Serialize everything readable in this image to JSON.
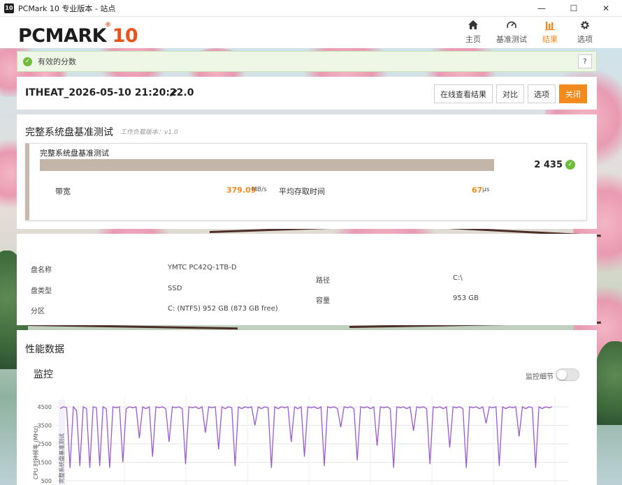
{
  "window": {
    "app_icon": "10",
    "title": "PCMark 10 专业版本 - 站点",
    "controls": [
      "—",
      "☐",
      "✕"
    ]
  },
  "logo": {
    "text": "PCMARK",
    "number": "10",
    "mark": "®"
  },
  "nav": {
    "items": [
      {
        "label": "主页",
        "icon": "home-icon"
      },
      {
        "label": "基准测试",
        "icon": "gauge-icon"
      },
      {
        "label": "结果",
        "icon": "bar-chart-icon",
        "active": true
      },
      {
        "label": "选项",
        "icon": "gear-icon"
      }
    ]
  },
  "colors": {
    "accent": "#f28a1e",
    "valid": "#6fbb3a",
    "series": "#9b59d0"
  },
  "validity": {
    "text": "有效的分数",
    "help": "?"
  },
  "result": {
    "name": "ITHEAT_2026-05-10 21:20:22.0",
    "buttons": {
      "online": "在线查看结果",
      "compare": "对比",
      "options": "选项",
      "close": "关闭"
    }
  },
  "benchmark": {
    "title": "完整系统盘基准测试",
    "version": "工作负载版本：v1.0",
    "inner_title": "完整系统盘基准测试",
    "score": "2 435",
    "bandwidth_label": "带宽",
    "bandwidth_value": "379.09",
    "bandwidth_unit": "MB/s",
    "latency_label": "平均存取时间",
    "latency_value": "67",
    "latency_unit": "μs"
  },
  "drive": {
    "name_label": "盘名称",
    "name_value": "YMTC PC42Q-1TB-D",
    "type_label": "盘类型",
    "type_value": "SSD",
    "partition_label": "分区",
    "partition_value": "C: (NTFS) 952 GB (873 GB free)",
    "path_label": "路径",
    "path_value": "C:\\",
    "capacity_label": "容量",
    "capacity_value": "953 GB"
  },
  "performance": {
    "title": "性能数据",
    "monitor_title": "监控",
    "toggle_label": "监控细节",
    "toggle_on": false
  },
  "chart_data": {
    "type": "line",
    "ylabel": "CPU 时钟频率 (MHz)",
    "overlay_label": "完整系统盘基准测试",
    "yticks": [
      500,
      1500,
      2500,
      3500,
      4500
    ],
    "ylim": [
      0,
      4800
    ],
    "grid": true,
    "series": [
      {
        "values": [
          4400,
          4500,
          4450,
          1200,
          4500,
          4300,
          1300,
          4500,
          4400,
          1200,
          4500,
          4450,
          1300,
          4500,
          4400,
          1200,
          4500,
          4450,
          4500,
          1500,
          4400,
          4500,
          4450,
          4500,
          2800,
          4500,
          4400,
          4500,
          1800,
          4500,
          4450,
          4500,
          4400,
          2600,
          4500,
          4450,
          4500,
          4400,
          1400,
          4500,
          4450,
          4500,
          4400,
          4500,
          3100,
          4500,
          4450,
          4500,
          2200,
          4500,
          4400,
          4500,
          4450,
          1300,
          4500,
          4400,
          4500,
          4450,
          4500,
          3500,
          4500,
          4400,
          4500,
          4450,
          1200,
          4500,
          4400,
          4500,
          4450,
          4500,
          2600,
          4500,
          4400,
          4500,
          1800,
          4500,
          4450,
          4500,
          4400,
          4500,
          1300,
          4500,
          4450,
          4500,
          4400,
          3400,
          4500,
          4450,
          4500,
          4400,
          1600,
          4500,
          4450,
          4500,
          4400,
          4500,
          2400,
          4500,
          4450,
          4500,
          4400,
          1200,
          4500,
          4450,
          4500,
          4400,
          4500,
          3200,
          4500,
          4450,
          4500,
          4400,
          1400,
          4500,
          4450,
          4500,
          4400,
          4500,
          2300,
          4500,
          4450,
          4500,
          4400,
          1200,
          4500,
          4450,
          4500,
          4400,
          4500,
          3600,
          4500,
          4450,
          4500,
          1300,
          4500,
          4400,
          4500,
          4450,
          4500,
          2900,
          4500,
          4400,
          4500,
          4450,
          1200,
          4500,
          4400,
          4500,
          4450,
          4500
        ]
      }
    ]
  }
}
